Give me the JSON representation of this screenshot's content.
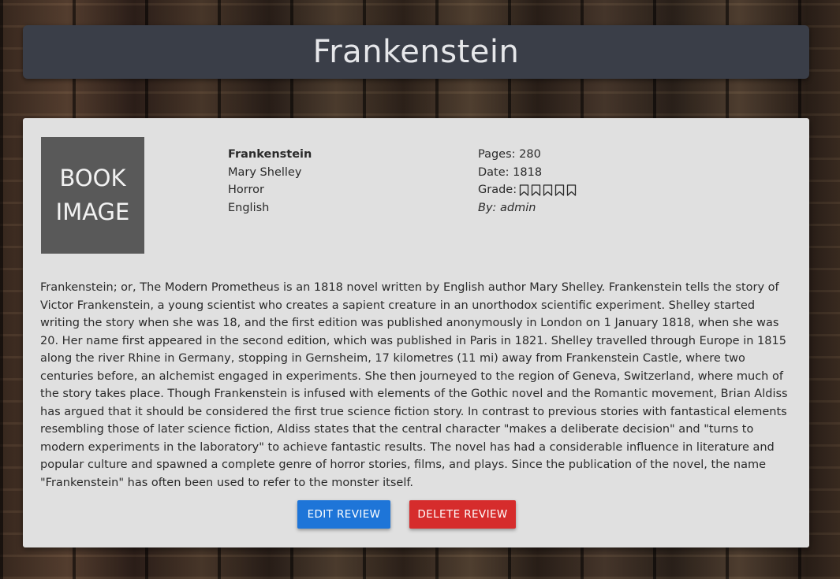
{
  "header": {
    "title": "Frankenstein"
  },
  "book": {
    "image_placeholder": "BOOK IMAGE",
    "title": "Frankenstein",
    "author": "Mary Shelley",
    "genre": "Horror",
    "language": "English",
    "pages_text": "Pages: 280",
    "date_text": "Date: 1818",
    "grade_label": "Grade:",
    "grade_stars_filled": 0,
    "grade_stars_total": 5,
    "by_text": "By: admin"
  },
  "description": "Frankenstein; or, The Modern Prometheus is an 1818 novel written by English author Mary Shelley. Frankenstein tells the story of Victor Frankenstein, a young scientist who creates a sapient creature in an unorthodox scientific experiment. Shelley started writing the story when she was 18, and the first edition was published anonymously in London on 1 January 1818, when she was 20. Her name first appeared in the second edition, which was published in Paris in 1821. Shelley travelled through Europe in 1815 along the river Rhine in Germany, stopping in Gernsheim, 17 kilometres (11 mi) away from Frankenstein Castle, where two centuries before, an alchemist engaged in experiments. She then journeyed to the region of Geneva, Switzerland, where much of the story takes place. Though Frankenstein is infused with elements of the Gothic novel and the Romantic movement, Brian Aldiss has argued that it should be considered the first true science fiction story. In contrast to previous stories with fantastical elements resembling those of later science fiction, Aldiss states that the central character \"makes a deliberate decision\" and \"turns to modern experiments in the laboratory\" to achieve fantastic results. The novel has had a considerable influence in literature and popular culture and spawned a complete genre of horror stories, films, and plays. Since the publication of the novel, the name \"Frankenstein\" has often been used to refer to the monster itself.",
  "actions": {
    "edit_label": "EDIT REVIEW",
    "delete_label": "DELETE REVIEW"
  },
  "colors": {
    "header_bg": "#3a3e48",
    "card_bg": "#e0e0e0",
    "edit_button": "#1e75d8",
    "delete_button": "#d62c2c",
    "image_placeholder_bg": "#595959"
  },
  "icons": {
    "grade_star": "bookmark-outline-icon"
  }
}
